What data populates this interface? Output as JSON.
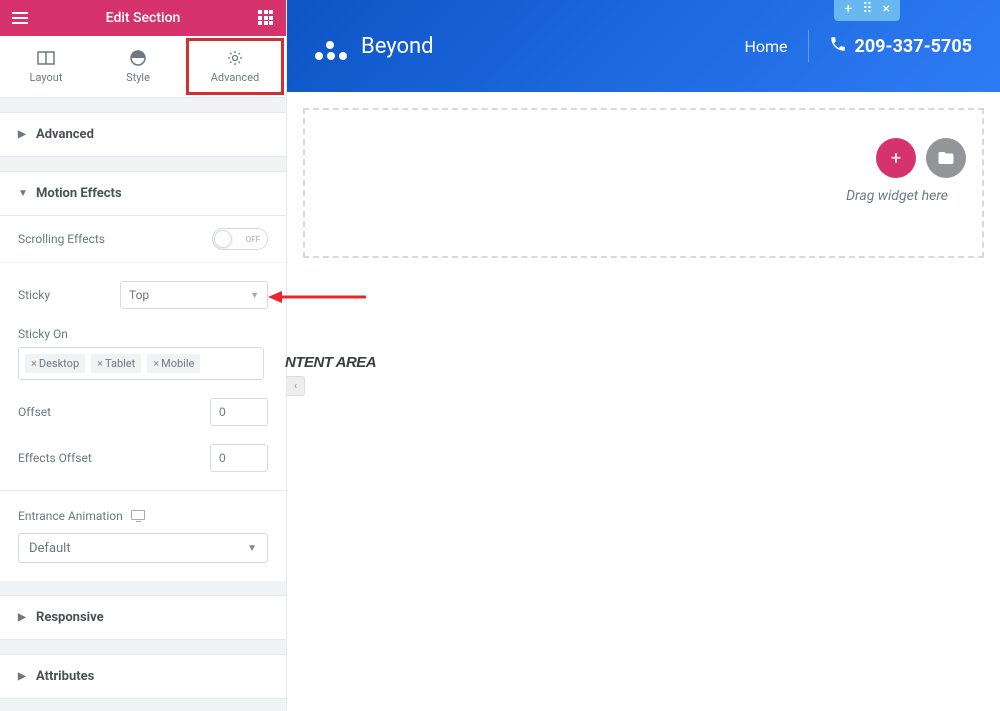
{
  "header": {
    "title": "Edit Section"
  },
  "tabs": {
    "layout": "Layout",
    "style": "Style",
    "advanced": "Advanced"
  },
  "sections": {
    "advanced": "Advanced",
    "motion_effects": "Motion Effects",
    "responsive": "Responsive",
    "attributes": "Attributes"
  },
  "motion": {
    "scrolling_effects_label": "Scrolling Effects",
    "toggle_off": "OFF",
    "sticky_label": "Sticky",
    "sticky_value": "Top",
    "sticky_on_label": "Sticky On",
    "chips": {
      "desktop": "Desktop",
      "tablet": "Tablet",
      "mobile": "Mobile"
    },
    "offset_label": "Offset",
    "offset_value": "0",
    "effects_offset_label": "Effects Offset",
    "effects_offset_value": "0",
    "entrance_label": "Entrance Animation",
    "entrance_value": "Default"
  },
  "preview": {
    "brand": "Beyond",
    "nav_home": "Home",
    "phone": "209-337-5705",
    "drag_hint": "Drag widget here",
    "content_area": "NTENT AREA"
  }
}
